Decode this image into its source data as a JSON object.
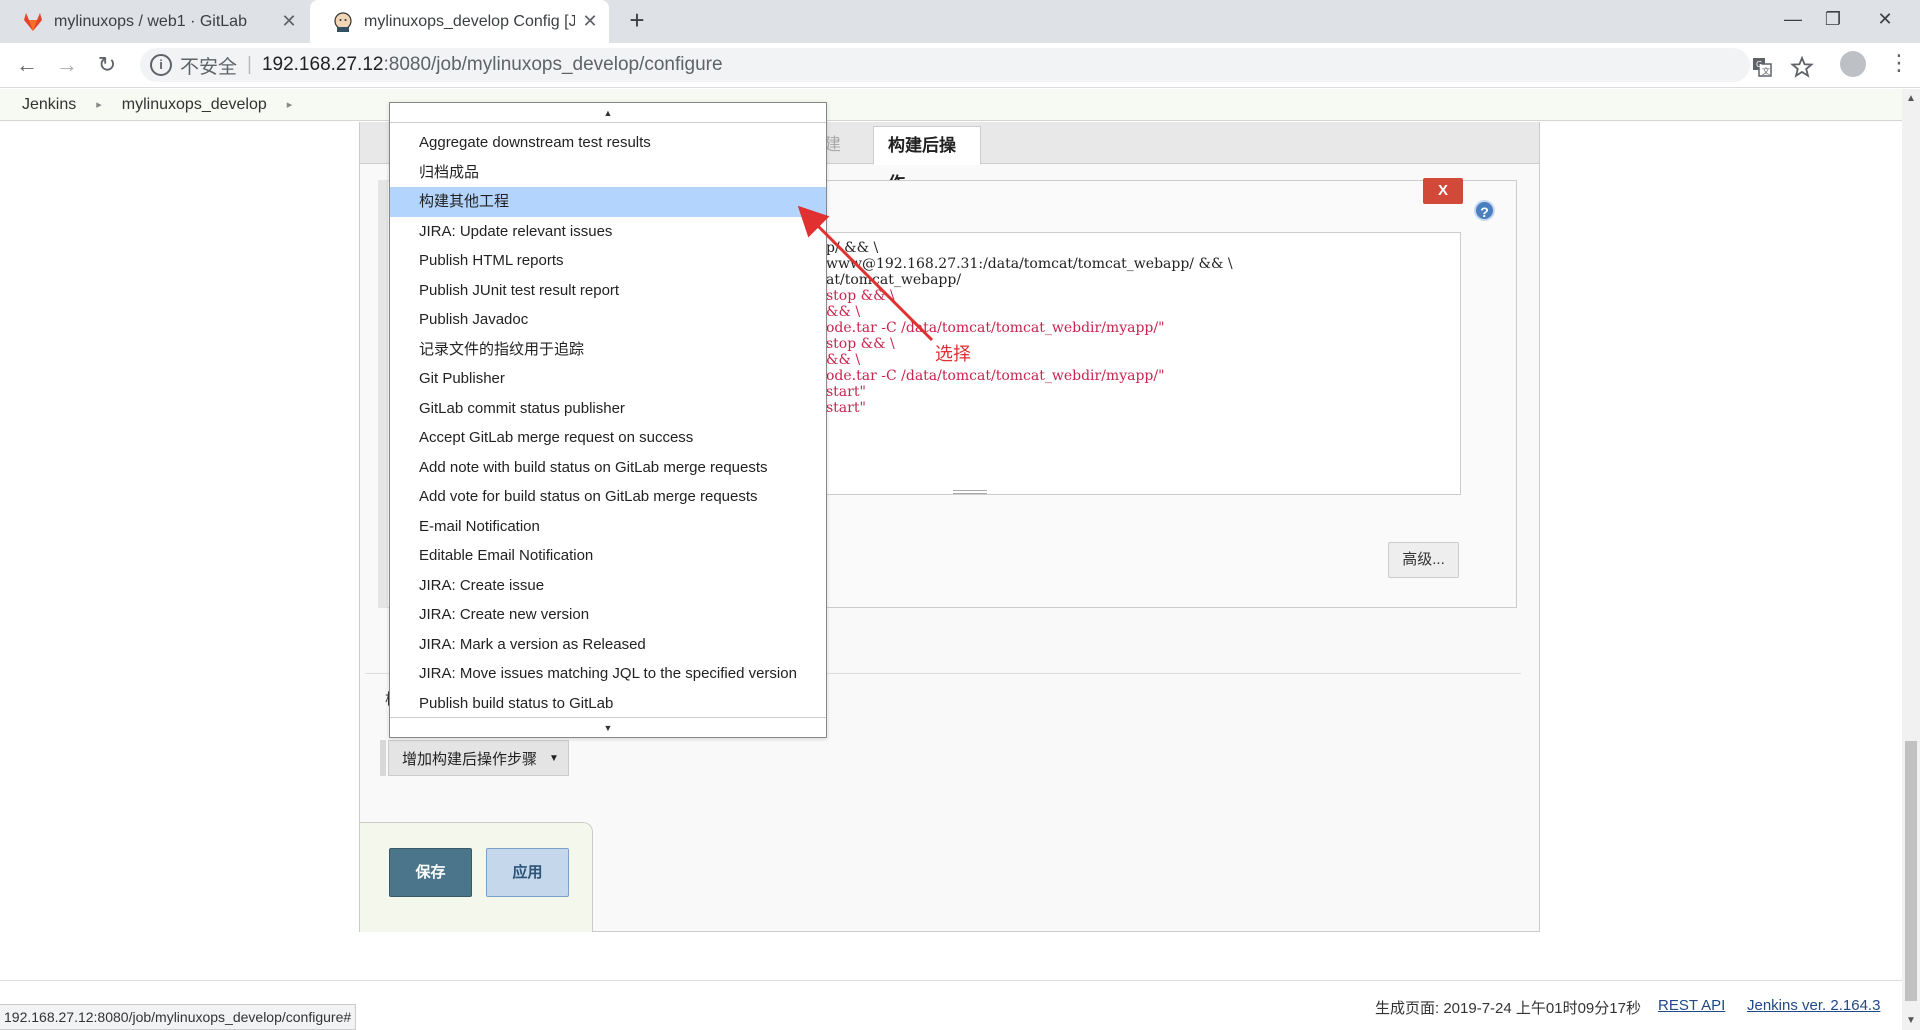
{
  "browser": {
    "tabs": [
      {
        "title": "mylinuxops / web1 · GitLab",
        "close": "✕"
      },
      {
        "title": "mylinuxops_develop Config [Je",
        "close": "✕"
      }
    ],
    "new_tab": "+",
    "window": {
      "minimize": "—",
      "maximize": "❐",
      "close": "✕"
    },
    "nav": {
      "back": "←",
      "forward": "→",
      "reload": "↻"
    },
    "address": {
      "security_label": "不安全",
      "separator": "|",
      "host": "192.168.27.12",
      "path": ":8080/job/mylinuxops_develop/configure"
    },
    "icons": {
      "translate": "translate-icon",
      "bookmark": "star-icon",
      "menu": "⋮"
    }
  },
  "breadcrumb": {
    "items": [
      "Jenkins",
      "mylinuxops_develop"
    ],
    "arrow": "▸"
  },
  "config": {
    "ghost_tab": "建",
    "active_tab": "构建后操作",
    "delete_label": "X",
    "help_label": "?",
    "code_lines": [
      {
        "text": "p/ && \\",
        "red": false
      },
      {
        "text": "www@192.168.27.31:/data/tomcat/tomcat_webapp/ && \\",
        "red": false
      },
      {
        "text": "at/tomcat_webapp/",
        "red": false
      },
      {
        "text": "stop && \\",
        "red": true
      },
      {
        "text": "&& \\",
        "red": true
      },
      {
        "text": "ode.tar -C /data/tomcat/tomcat_webdir/myapp/\"",
        "red": true
      },
      {
        "text": "stop && \\",
        "red": true
      },
      {
        "text": "&& \\",
        "red": true
      },
      {
        "text": "ode.tar -C /data/tomcat/tomcat_webdir/myapp/\"",
        "red": true
      },
      {
        "text": "start\"",
        "red": true
      },
      {
        "text": "start\"",
        "red": true
      }
    ],
    "advanced_label": "高级...",
    "partial_heading": "构",
    "add_step_label": "增加构建后操作步骤",
    "add_step_caret": "▼",
    "save_label": "保存",
    "apply_label": "应用"
  },
  "dropdown": {
    "scroll_up": "▲",
    "scroll_down": "▼",
    "selected_index": 2,
    "items": [
      "Aggregate downstream test results",
      "归档成品",
      "构建其他工程",
      "JIRA: Update relevant issues",
      "Publish HTML reports",
      "Publish JUnit test result report",
      "Publish Javadoc",
      "记录文件的指纹用于追踪",
      "Git Publisher",
      "GitLab commit status publisher",
      "Accept GitLab merge request on success",
      "Add note with build status on GitLab merge requests",
      "Add vote for build status on GitLab merge requests",
      "E-mail Notification",
      "Editable Email Notification",
      "JIRA: Create issue",
      "JIRA: Create new version",
      "JIRA: Mark a version as Released",
      "JIRA: Move issues matching JQL to the specified version",
      "Publish build status to GitLab"
    ]
  },
  "annotation": {
    "label": "选择",
    "color": "#e03030"
  },
  "footer": {
    "generated": "生成页面: 2019-7-24 上午01时09分17秒",
    "rest_api": "REST API",
    "version": "Jenkins ver. 2.164.3"
  },
  "status_url": "192.168.27.12:8080/job/mylinuxops_develop/configure#"
}
